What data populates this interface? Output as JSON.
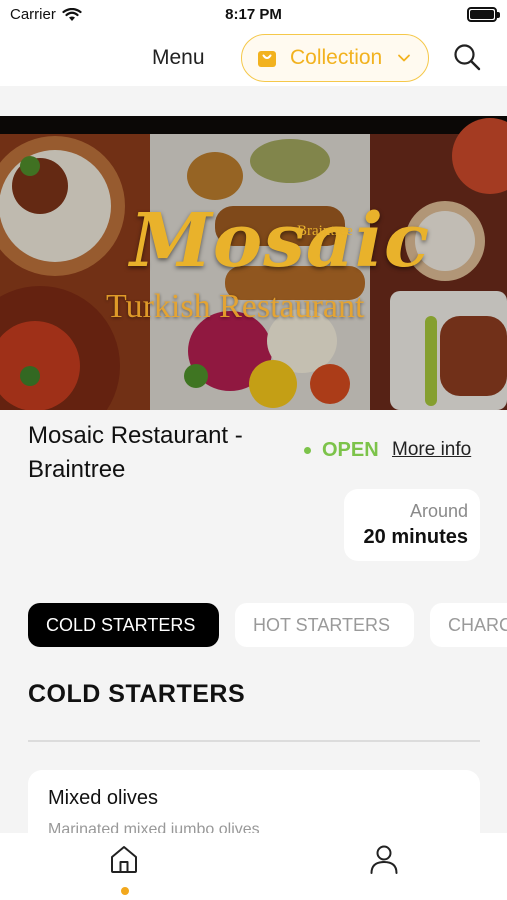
{
  "status_bar": {
    "carrier": "Carrier",
    "time": "8:17 PM"
  },
  "header": {
    "menu_title": "Menu",
    "collection_label": "Collection",
    "accent_color": "#f2b21f"
  },
  "hero": {
    "brand_main": "Mosaic",
    "brand_sub": "Braintree",
    "brand_tag": "Turkish Restaurant"
  },
  "restaurant": {
    "name": "Mosaic Restaurant - Braintree",
    "status": "OPEN",
    "status_color": "#7cc34a",
    "more_info": "More info",
    "wait_prefix": "Around",
    "wait_value": "20 minutes"
  },
  "categories": {
    "tabs": [
      {
        "label": "COLD STARTERS",
        "active": true
      },
      {
        "label": "HOT STARTERS",
        "active": false
      },
      {
        "label": "CHARCOAL GRILL",
        "active": false
      }
    ]
  },
  "section": {
    "title": "COLD STARTERS",
    "items": [
      {
        "name": "Mixed olives",
        "description": "Marinated mixed jumbo olives"
      }
    ]
  },
  "bottom_nav": {
    "items": [
      {
        "icon": "home-icon",
        "active": true
      },
      {
        "icon": "profile-icon",
        "active": false
      }
    ]
  }
}
